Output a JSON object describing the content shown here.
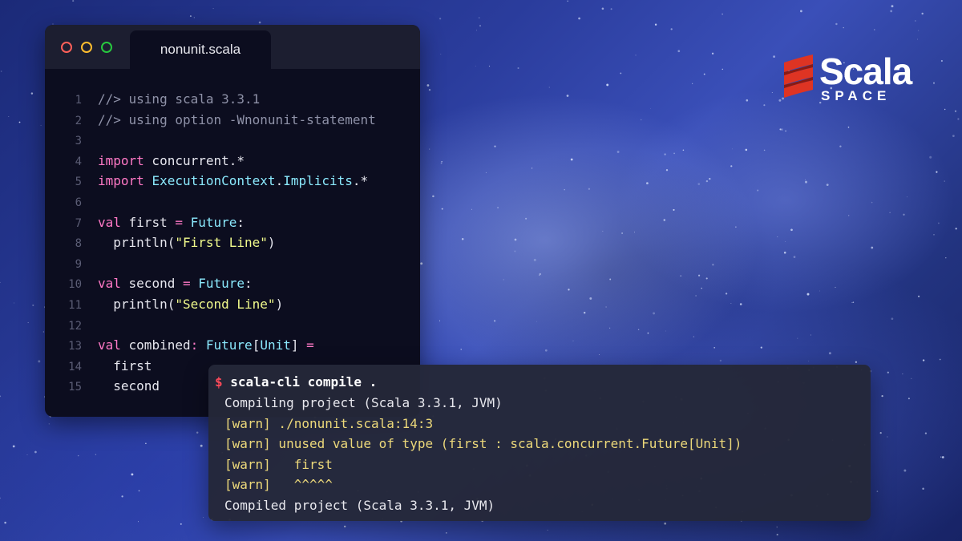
{
  "editor": {
    "tab_title": "nonunit.scala",
    "lines": [
      {
        "n": "1",
        "parts": [
          {
            "c": "cm",
            "t": "//> using scala 3.3.1"
          }
        ]
      },
      {
        "n": "2",
        "parts": [
          {
            "c": "cm",
            "t": "//> using option -Wnonunit-statement"
          }
        ]
      },
      {
        "n": "3",
        "parts": []
      },
      {
        "n": "4",
        "parts": [
          {
            "c": "kw",
            "t": "import"
          },
          {
            "c": "pl",
            "t": " concurrent.*"
          }
        ]
      },
      {
        "n": "5",
        "parts": [
          {
            "c": "kw",
            "t": "import"
          },
          {
            "c": "pl",
            "t": " "
          },
          {
            "c": "ty",
            "t": "ExecutionContext"
          },
          {
            "c": "pl",
            "t": "."
          },
          {
            "c": "ty",
            "t": "Implicits"
          },
          {
            "c": "pl",
            "t": ".*"
          }
        ]
      },
      {
        "n": "6",
        "parts": []
      },
      {
        "n": "7",
        "parts": [
          {
            "c": "kw",
            "t": "val"
          },
          {
            "c": "pl",
            "t": " first "
          },
          {
            "c": "kw",
            "t": "="
          },
          {
            "c": "pl",
            "t": " "
          },
          {
            "c": "ty",
            "t": "Future"
          },
          {
            "c": "pl",
            "t": ":"
          }
        ]
      },
      {
        "n": "8",
        "parts": [
          {
            "c": "pl",
            "t": "  println("
          },
          {
            "c": "st",
            "t": "\"First Line\""
          },
          {
            "c": "pl",
            "t": ")"
          }
        ]
      },
      {
        "n": "9",
        "parts": []
      },
      {
        "n": "10",
        "parts": [
          {
            "c": "kw",
            "t": "val"
          },
          {
            "c": "pl",
            "t": " second "
          },
          {
            "c": "kw",
            "t": "="
          },
          {
            "c": "pl",
            "t": " "
          },
          {
            "c": "ty",
            "t": "Future"
          },
          {
            "c": "pl",
            "t": ":"
          }
        ]
      },
      {
        "n": "11",
        "parts": [
          {
            "c": "pl",
            "t": "  println("
          },
          {
            "c": "st",
            "t": "\"Second Line\""
          },
          {
            "c": "pl",
            "t": ")"
          }
        ]
      },
      {
        "n": "12",
        "parts": []
      },
      {
        "n": "13",
        "parts": [
          {
            "c": "kw",
            "t": "val"
          },
          {
            "c": "pl",
            "t": " combined"
          },
          {
            "c": "kw",
            "t": ":"
          },
          {
            "c": "pl",
            "t": " "
          },
          {
            "c": "ty",
            "t": "Future"
          },
          {
            "c": "pl",
            "t": "["
          },
          {
            "c": "ty",
            "t": "Unit"
          },
          {
            "c": "pl",
            "t": "] "
          },
          {
            "c": "kw",
            "t": "="
          }
        ]
      },
      {
        "n": "14",
        "parts": [
          {
            "c": "pl",
            "t": "  first"
          }
        ]
      },
      {
        "n": "15",
        "parts": [
          {
            "c": "pl",
            "t": "  second"
          }
        ]
      }
    ]
  },
  "terminal": {
    "prompt_symbol": "$",
    "command": "scala-cli compile .",
    "output": [
      {
        "kind": "normal",
        "text": "Compiling project (Scala 3.3.1, JVM)"
      },
      {
        "kind": "warn",
        "text": "[warn] ./nonunit.scala:14:3"
      },
      {
        "kind": "warn",
        "text": "[warn] unused value of type (first : scala.concurrent.Future[Unit])"
      },
      {
        "kind": "warn",
        "text": "[warn]   first"
      },
      {
        "kind": "warn",
        "text": "[warn]   ^^^^^"
      },
      {
        "kind": "normal",
        "text": "Compiled project (Scala 3.3.1, JVM)"
      }
    ]
  },
  "logo": {
    "word": "Scala",
    "sub": "SPACE"
  },
  "colors": {
    "keyword": "#ff79c6",
    "type": "#8be9fd",
    "string": "#f1fa8c",
    "comment": "#8f92a8",
    "warn": "#ecd87a",
    "scala_red": "#de3423"
  }
}
